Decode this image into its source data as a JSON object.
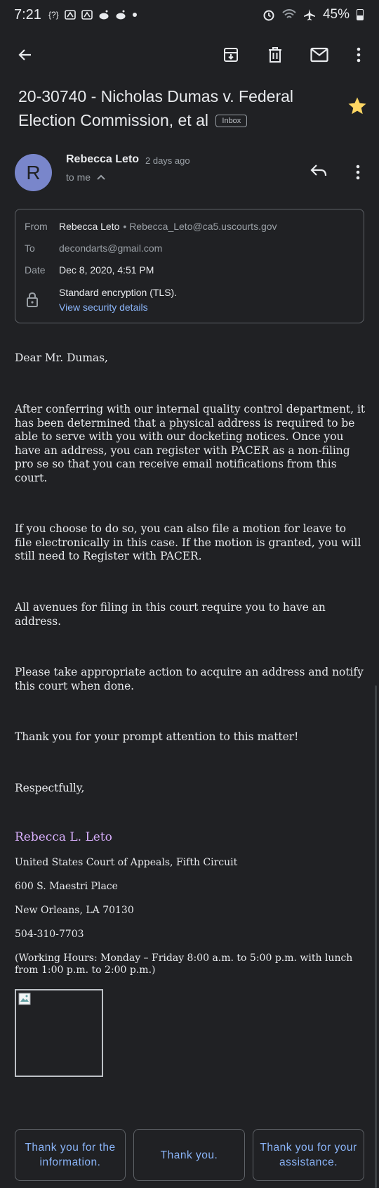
{
  "status_bar": {
    "time": "7:21",
    "left_icons_text": "{?}",
    "battery_percent": "45%"
  },
  "toolbar": {
    "icons": [
      "back-arrow-icon",
      "archive-icon",
      "delete-icon",
      "mark-unread-icon",
      "more-vert-icon"
    ]
  },
  "email": {
    "subject": "20-30740 - Nicholas Dumas v. Federal Election Commission, et al",
    "label": "Inbox",
    "starred": true,
    "sender": {
      "initial": "R",
      "name": "Rebecca Leto",
      "time": "2 days ago",
      "to_line": "to me"
    },
    "details": {
      "from_label": "From",
      "from_name": "Rebecca Leto",
      "from_email": "• Rebecca_Leto@ca5.uscourts.gov",
      "to_label": "To",
      "to_value": "decondarts@gmail.com",
      "date_label": "Date",
      "date_value": "Dec 8, 2020, 4:51 PM",
      "security_text": "Standard encryption (TLS).",
      "security_link": "View security details"
    },
    "body": {
      "greeting": "Dear Mr. Dumas,",
      "p1": "After conferring with our internal quality control department, it has been determined that a physical address is required to be able to serve with you with our docketing notices.  Once you have an address, you can register with PACER as a non-filing pro se so that you can receive email notifications from this court.",
      "p2": "If you choose to do so, you can also file a motion for leave to file electronically in this case.  If the motion is granted, you will still need to Register with PACER.",
      "p3": "All avenues for filing in this court require you to have an address.",
      "p4": "Please take appropriate action to acquire an address and notify this court when done.",
      "p5": "Thank you for your prompt attention to this matter!",
      "closing": "Respectfully,"
    },
    "signature": {
      "name": "Rebecca L. Leto",
      "org": "United States Court of Appeals, Fifth Circuit",
      "street": "600 S. Maestri Place",
      "city": "New Orleans, LA  70130",
      "phone": "504-310-7703",
      "hours": "(Working Hours: Monday – Friday 8:00 a.m. to 5:00 p.m. with lunch from 1:00 p.m. to 2:00 p.m.)"
    }
  },
  "smart_replies": [
    "Thank you for the information.",
    "Thank you.",
    "Thank you for your assistance."
  ],
  "colors": {
    "background": "#202124",
    "text": "#e8eaed",
    "secondary": "#9aa0a6",
    "link": "#8ab4f8",
    "avatar": "#7986cb",
    "star": "#fdd663",
    "signature_name": "#d7aefb"
  }
}
